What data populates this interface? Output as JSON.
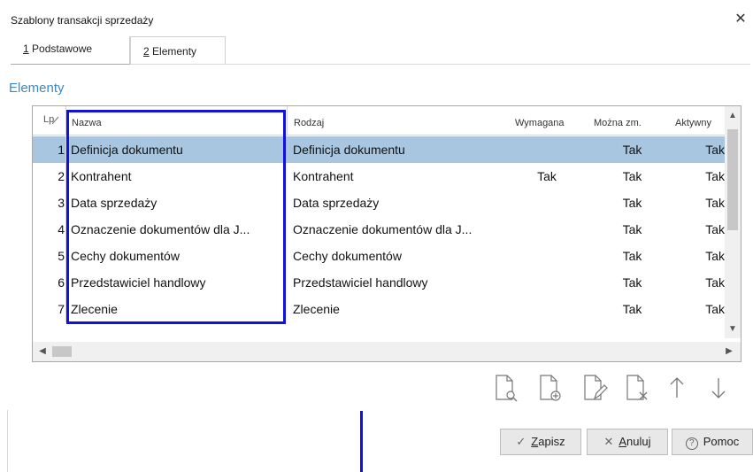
{
  "window": {
    "title": "Szablony transakcji sprzedaży",
    "close_glyph": "✕"
  },
  "tabs": [
    {
      "key": "1",
      "rest": " Podstawowe",
      "active": false
    },
    {
      "key": "2",
      "rest": " Elementy",
      "active": true
    }
  ],
  "section_title": "Elementy",
  "grid": {
    "columns": {
      "lp": "Lp",
      "nazwa": "Nazwa",
      "rodzaj": "Rodzaj",
      "wymagana": "Wymagana",
      "mozna_zm": "Można zm.",
      "aktywny": "Aktywny"
    },
    "rows": [
      {
        "lp": "1",
        "nazwa": "Definicja dokumentu",
        "rodzaj": "Definicja dokumentu",
        "wymagana": "",
        "mozna_zm": "Tak",
        "aktywny": "Tak"
      },
      {
        "lp": "2",
        "nazwa": "Kontrahent",
        "rodzaj": "Kontrahent",
        "wymagana": "Tak",
        "mozna_zm": "Tak",
        "aktywny": "Tak"
      },
      {
        "lp": "3",
        "nazwa": "Data sprzedaży",
        "rodzaj": "Data sprzedaży",
        "wymagana": "",
        "mozna_zm": "Tak",
        "aktywny": "Tak"
      },
      {
        "lp": "4",
        "nazwa": "Oznaczenie dokumentów dla J...",
        "rodzaj": "Oznaczenie dokumentów dla J...",
        "wymagana": "",
        "mozna_zm": "Tak",
        "aktywny": "Tak"
      },
      {
        "lp": "5",
        "nazwa": "Cechy dokumentów",
        "rodzaj": "Cechy dokumentów",
        "wymagana": "",
        "mozna_zm": "Tak",
        "aktywny": "Tak"
      },
      {
        "lp": "6",
        "nazwa": "Przedstawiciel handlowy",
        "rodzaj": "Przedstawiciel handlowy",
        "wymagana": "",
        "mozna_zm": "Tak",
        "aktywny": "Tak"
      },
      {
        "lp": "7",
        "nazwa": "Zlecenie",
        "rodzaj": "Zlecenie",
        "wymagana": "",
        "mozna_zm": "Tak",
        "aktywny": "Tak"
      }
    ],
    "selected_row": 0
  },
  "toolbar": {
    "icons": [
      "document-preview-icon",
      "document-add-icon",
      "document-edit-icon",
      "document-delete-icon",
      "arrow-up-icon",
      "arrow-down-icon"
    ]
  },
  "buttons": {
    "save": {
      "glyph": "✓",
      "key": "Z",
      "rest": "apisz"
    },
    "cancel": {
      "glyph": "✕",
      "key": "A",
      "rest": "nuluj"
    },
    "help": {
      "glyph": "?",
      "label": "Pomoc"
    }
  },
  "colors": {
    "accent": "#3d8ac4",
    "selection": "#a8c6e0",
    "highlight": "#1010e0"
  }
}
